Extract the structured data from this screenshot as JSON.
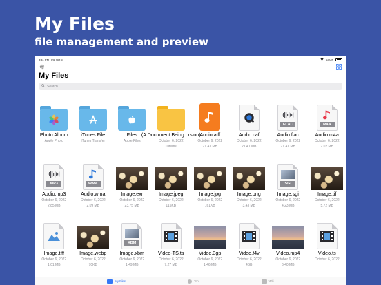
{
  "promo": {
    "title": "My Files",
    "subtitle": "file management and preview"
  },
  "status": {
    "time": "9:41 PM",
    "date": "Thu Oct 5",
    "battery": "100%"
  },
  "header": {
    "title": "My Files",
    "settings_icon": "gear-icon",
    "grid_icon": "grid-view-icon"
  },
  "search": {
    "placeholder": "Search"
  },
  "items": [
    {
      "name": "Photo Album",
      "meta1": "Apple Photo",
      "meta2": "",
      "kind": "folder",
      "accent": "#68b8ea",
      "glyph": "photos"
    },
    {
      "name": "iTunes File",
      "meta1": "iTunes Transfer",
      "meta2": "",
      "kind": "folder",
      "accent": "#68b8ea",
      "glyph": "apps"
    },
    {
      "name": "Files",
      "meta1": "Apple Files",
      "meta2": "",
      "kind": "folder",
      "accent": "#68b8ea",
      "glyph": "apple"
    },
    {
      "name": "(A Document Being...rsion)",
      "meta1": "October 6, 2022",
      "meta2": "0 items",
      "kind": "folder",
      "accent": "#f9c443",
      "glyph": ""
    },
    {
      "name": "Audio.aiff",
      "meta1": "October 6, 2022",
      "meta2": "21.41 MB",
      "kind": "music",
      "accent": "#f57c1f"
    },
    {
      "name": "Audio.caf",
      "meta1": "October 6, 2022",
      "meta2": "21.41 MB",
      "kind": "quicktime"
    },
    {
      "name": "Audio.flac",
      "meta1": "October 6, 2022",
      "meta2": "21.41 MB",
      "kind": "doc",
      "label": "FLAC",
      "wave": true
    },
    {
      "name": "Audio.m4a",
      "meta1": "October 6, 2022",
      "meta2": "2.02 MB",
      "kind": "doc",
      "label": "M4A",
      "note": "#e8394b"
    },
    {
      "name": "Audio.mp3",
      "meta1": "October 6, 2022",
      "meta2": "2.85 MB",
      "kind": "doc",
      "label": "MP3",
      "wave": true
    },
    {
      "name": "Audio.wma",
      "meta1": "October 6, 2022",
      "meta2": "2.09 MB",
      "kind": "doc",
      "label": "WMA",
      "note": "#2b77d9"
    },
    {
      "name": "Image.exr",
      "meta1": "October 6, 2022",
      "meta2": "23.75 MB",
      "kind": "photo",
      "style": "bokeh"
    },
    {
      "name": "Image.jpeg",
      "meta1": "October 6, 2022",
      "meta2": "115KB",
      "kind": "photo",
      "style": "bokeh"
    },
    {
      "name": "Image.jpg",
      "meta1": "October 6, 2022",
      "meta2": "161KB",
      "kind": "photo",
      "style": "bokeh"
    },
    {
      "name": "Image.png",
      "meta1": "October 6, 2022",
      "meta2": "3.43 MB",
      "kind": "photo",
      "style": "bokeh"
    },
    {
      "name": "Image.sgi",
      "meta1": "October 6, 2022",
      "meta2": "4.23 MB",
      "kind": "doc",
      "label": "SGI",
      "picture": true
    },
    {
      "name": "Image.tif",
      "meta1": "October 6, 2022",
      "meta2": "5.72 MB",
      "kind": "photo",
      "style": "bokeh"
    },
    {
      "name": "Image.tiff",
      "meta1": "October 6, 2022",
      "meta2": "1.01 MB",
      "kind": "doc",
      "label": "",
      "mountain": true
    },
    {
      "name": "Image.webp",
      "meta1": "October 6, 2022",
      "meta2": "70KB",
      "kind": "photo",
      "style": "bokeh"
    },
    {
      "name": "Image.xbm",
      "meta1": "October 6, 2022",
      "meta2": "1.49 MB",
      "kind": "doc",
      "label": "XBM",
      "picture": true
    },
    {
      "name": "Video-TS.ts",
      "meta1": "October 6, 2022",
      "meta2": "7.27 MB",
      "kind": "video-doc"
    },
    {
      "name": "Video.3gp",
      "meta1": "October 6, 2022",
      "meta2": "1.46 MB",
      "kind": "photo",
      "style": "sunset"
    },
    {
      "name": "Video.f4v",
      "meta1": "October 6, 2022",
      "meta2": "4BB",
      "kind": "video-doc"
    },
    {
      "name": "Video.mp4",
      "meta1": "October 6, 2022",
      "meta2": "6.40 MB",
      "kind": "photo",
      "style": "sunset"
    },
    {
      "name": "Video.ts",
      "meta1": "October 6, 2022",
      "meta2": "",
      "kind": "video-doc"
    }
  ],
  "tabbar": {
    "tabs": [
      {
        "label": "My Files",
        "active": true
      },
      {
        "label": "Tool",
        "active": false
      },
      {
        "label": "Wifi",
        "active": false
      }
    ]
  }
}
